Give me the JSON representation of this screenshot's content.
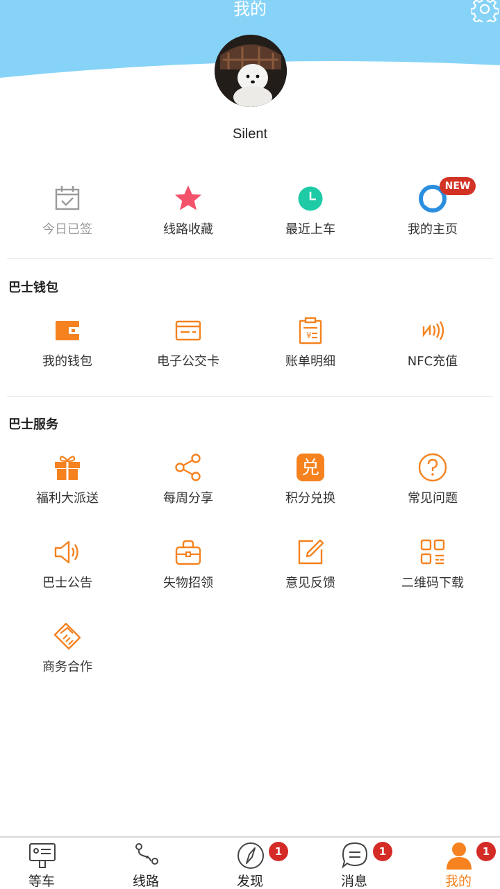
{
  "header": {
    "title": "我的"
  },
  "profile": {
    "username": "Silent"
  },
  "quick": [
    {
      "label": "今日已签",
      "icon": "calendar-check-icon"
    },
    {
      "label": "线路收藏",
      "icon": "star-icon"
    },
    {
      "label": "最近上车",
      "icon": "clock-icon"
    },
    {
      "label": "我的主页",
      "icon": "homepage-icon",
      "badge": "NEW"
    }
  ],
  "wallet": {
    "title": "巴士钱包",
    "items": [
      {
        "label": "我的钱包",
        "icon": "wallet-icon"
      },
      {
        "label": "电子公交卡",
        "icon": "card-icon"
      },
      {
        "label": "账单明细",
        "icon": "bill-icon"
      },
      {
        "label": "NFC充值",
        "icon": "nfc-icon"
      }
    ]
  },
  "service": {
    "title": "巴士服务",
    "items": [
      {
        "label": "福利大派送",
        "icon": "gift-icon"
      },
      {
        "label": "每周分享",
        "icon": "share-icon"
      },
      {
        "label": "积分兑换",
        "icon": "exchange-icon",
        "glyph": "兑"
      },
      {
        "label": "常见问题",
        "icon": "question-icon"
      },
      {
        "label": "巴士公告",
        "icon": "speaker-icon"
      },
      {
        "label": "失物招领",
        "icon": "bag-icon"
      },
      {
        "label": "意见反馈",
        "icon": "edit-icon"
      },
      {
        "label": "二维码下载",
        "icon": "qrcode-icon"
      },
      {
        "label": "商务合作",
        "icon": "handshake-icon"
      }
    ]
  },
  "tabs": [
    {
      "label": "等车",
      "icon": "bus-stop-icon"
    },
    {
      "label": "线路",
      "icon": "route-icon"
    },
    {
      "label": "发现",
      "icon": "compass-icon",
      "badge": "1"
    },
    {
      "label": "消息",
      "icon": "message-icon",
      "badge": "1"
    },
    {
      "label": "我的",
      "icon": "person-icon",
      "badge": "1",
      "active": true
    }
  ],
  "colors": {
    "header": "#87d3f8",
    "accent": "#f5821f",
    "badge": "#d52b26"
  }
}
